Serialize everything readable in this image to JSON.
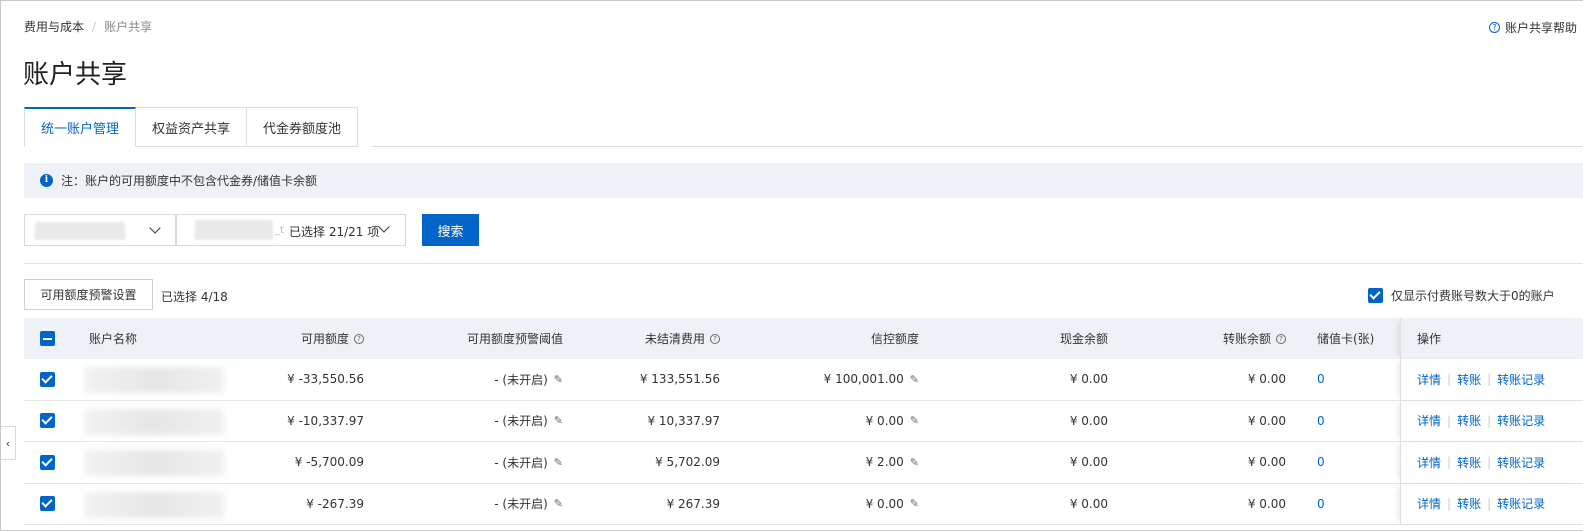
{
  "breadcrumb": {
    "parent": "费用与成本",
    "current": "账户共享"
  },
  "help_link": "账户共享帮助",
  "page_title": "账户共享",
  "tabs": [
    {
      "label": "统一账户管理",
      "active": true
    },
    {
      "label": "权益资产共享",
      "active": false
    },
    {
      "label": "代金券额度池",
      "active": false
    }
  ],
  "notice": {
    "icon": "info-icon",
    "text": "注：账户的可用额度中不包含代金券/储值卡余额"
  },
  "filters": {
    "select1_value": "",
    "select2_tail": "_t",
    "select2_summary": "已选择 21/21 项",
    "search_label": "搜索"
  },
  "toolbar": {
    "warning_settings_label": "可用额度预警设置",
    "selected_count": "已选择 4/18",
    "only_positive_label": "仅显示付费账号数大于0的账户",
    "only_positive_checked": true
  },
  "table": {
    "headers": {
      "name": "账户名称",
      "available": "可用额度",
      "threshold": "可用额度预警阈值",
      "unsettled": "未结清费用",
      "credit": "信控额度",
      "cash": "现金余额",
      "transfer": "转账余额",
      "stored_card": "储值卡(张)",
      "ops": "操作"
    },
    "rows": [
      {
        "name": "",
        "available": "¥ -33,550.56",
        "threshold": "- (未开启)",
        "unsettled": "¥ 133,551.56",
        "credit": "¥ 100,001.00",
        "cash": "¥ 0.00",
        "transfer": "¥ 0.00",
        "stored_card": "0"
      },
      {
        "name": "",
        "available": "¥ -10,337.97",
        "threshold": "- (未开启)",
        "unsettled": "¥ 10,337.97",
        "credit": "¥ 0.00",
        "cash": "¥ 0.00",
        "transfer": "¥ 0.00",
        "stored_card": "0"
      },
      {
        "name": "",
        "available": "¥ -5,700.09",
        "threshold": "- (未开启)",
        "unsettled": "¥ 5,702.09",
        "credit": "¥ 2.00",
        "cash": "¥ 0.00",
        "transfer": "¥ 0.00",
        "stored_card": "0"
      },
      {
        "name": "",
        "available": "¥ -267.39",
        "threshold": "- (未开启)",
        "unsettled": "¥ 267.39",
        "credit": "¥ 0.00",
        "cash": "¥ 0.00",
        "transfer": "¥ 0.00",
        "stored_card": "0"
      }
    ],
    "ops": {
      "detail": "详情",
      "transfer": "转账",
      "records": "转账记录"
    }
  },
  "colors": {
    "accent": "#0064c8",
    "header_bg": "#eef2f6"
  }
}
